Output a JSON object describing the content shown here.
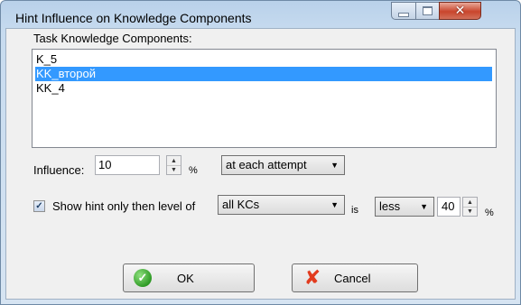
{
  "window": {
    "title": "Hint Influence on Knowledge Components",
    "controls": {
      "minimize": "minimize-icon",
      "maximize": "maximize-icon",
      "close": "close-icon"
    }
  },
  "task_kc": {
    "label": "Task Knowledge Components:",
    "items": [
      {
        "label": "K_5",
        "selected": false
      },
      {
        "label": "KK_второй",
        "selected": true
      },
      {
        "label": "KK_4",
        "selected": false
      }
    ]
  },
  "influence": {
    "label": "Influence:",
    "value": "10",
    "percent": "%",
    "mode": "at each attempt"
  },
  "show_hint": {
    "checked": true,
    "label": "Show hint only then level of",
    "kc_scope": "all KCs",
    "is_label": "is",
    "comparison": "less",
    "threshold": "40",
    "percent": "%"
  },
  "buttons": {
    "ok": "OK",
    "cancel": "Cancel"
  },
  "colors": {
    "selection": "#3399ff",
    "close_button": "#c9452c"
  }
}
